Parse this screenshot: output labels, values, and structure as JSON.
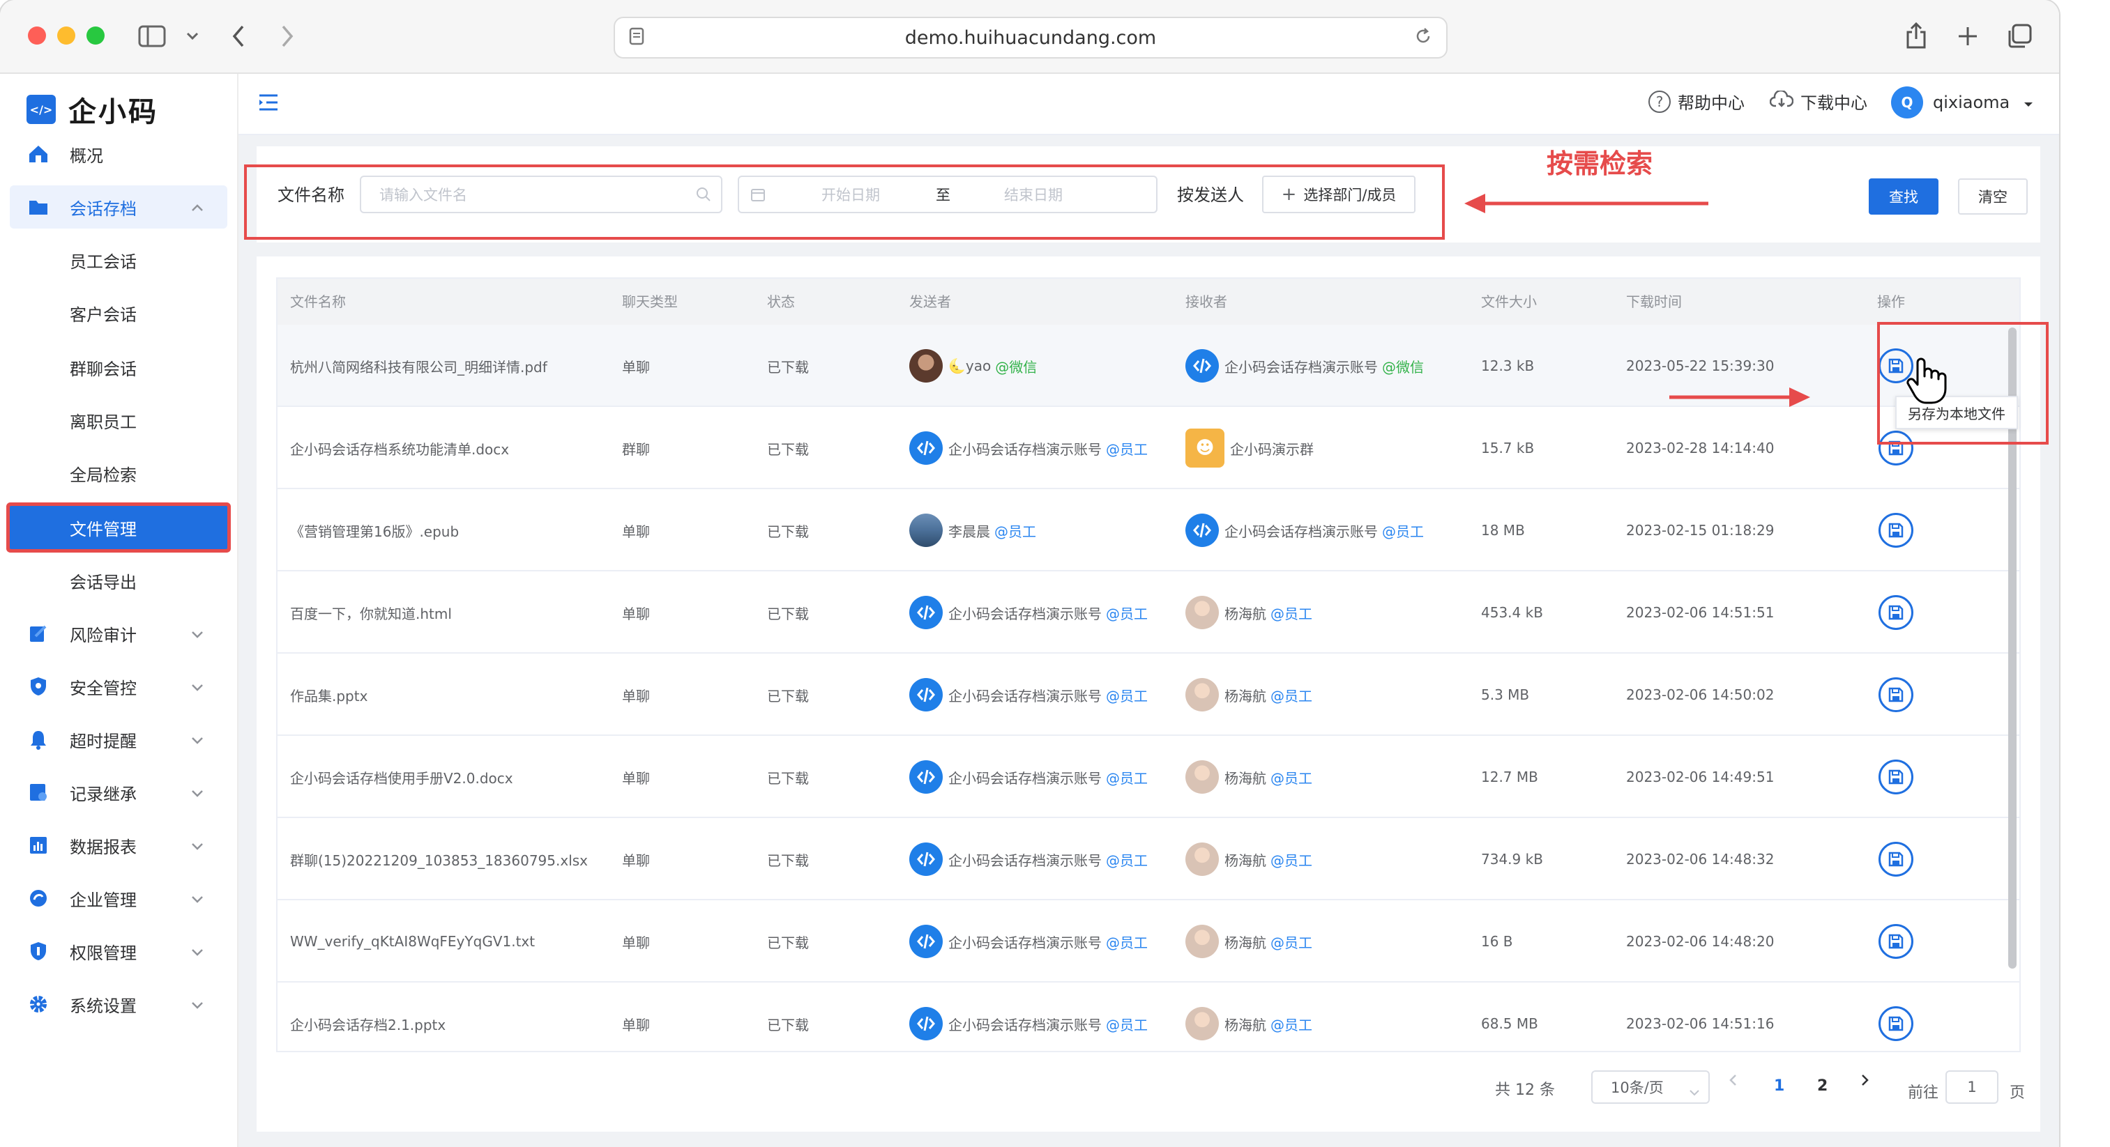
{
  "browser": {
    "url": "demo.huihuacundang.com"
  },
  "brand": {
    "name": "企小码",
    "logo_glyph": "</>",
    "primary_color": "#1f6fe0",
    "annotation_color": "#e64b4b"
  },
  "sidebar": {
    "items": [
      {
        "label": "概况",
        "icon": "home-icon"
      },
      {
        "label": "会话存档",
        "icon": "folder-icon",
        "expanded": true
      },
      {
        "label": "风险审计",
        "icon": "audit-icon"
      },
      {
        "label": "安全管控",
        "icon": "shield-icon"
      },
      {
        "label": "超时提醒",
        "icon": "bell-icon"
      },
      {
        "label": "记录继承",
        "icon": "inherit-icon"
      },
      {
        "label": "数据报表",
        "icon": "chart-icon"
      },
      {
        "label": "企业管理",
        "icon": "enterprise-icon"
      },
      {
        "label": "权限管理",
        "icon": "permission-icon"
      },
      {
        "label": "系统设置",
        "icon": "gear-icon"
      }
    ],
    "sub_items": [
      "员工会话",
      "客户会话",
      "群聊会话",
      "离职员工",
      "全局检索",
      "文件管理",
      "会话导出"
    ],
    "active_sub": "文件管理"
  },
  "header": {
    "help": "帮助中心",
    "download": "下载中心",
    "user": "qixiaoma",
    "avatar_letter": "Q"
  },
  "search": {
    "file_name_label": "文件名称",
    "file_name_placeholder": "请输入文件名",
    "start_date_placeholder": "开始日期",
    "date_separator": "至",
    "end_date_placeholder": "结束日期",
    "sender_label": "按发送人",
    "select_member": "选择部门/成员",
    "search_button": "查找",
    "clear_button": "清空",
    "annotation": "按需检索"
  },
  "table": {
    "columns": [
      "文件名称",
      "聊天类型",
      "状态",
      "发送者",
      "接收者",
      "文件大小",
      "下载时间",
      "操作"
    ],
    "rows": [
      {
        "file": "杭州八简网络科技有限公司_明细详情.pdf",
        "type": "单聊",
        "status": "已下载",
        "sender": "🌜yao",
        "sender_tag": "@微信",
        "sender_av": "photo1",
        "receiver": "企小码会话存档演示账号",
        "receiver_tag": "@微信",
        "receiver_av": "logo",
        "size": "12.3 kB",
        "time": "2023-05-22 15:39:30"
      },
      {
        "file": "企小码会话存档系统功能清单.docx",
        "type": "群聊",
        "status": "已下载",
        "sender": "企小码会话存档演示账号",
        "sender_tag": "@员工",
        "sender_av": "logo",
        "receiver": "企小码演示群",
        "receiver_tag": "",
        "receiver_av": "group",
        "size": "15.7 kB",
        "time": "2023-02-28 14:14:40"
      },
      {
        "file": "《营销管理第16版》.epub",
        "type": "单聊",
        "status": "已下载",
        "sender": "李晨晨",
        "sender_tag": "@员工",
        "sender_av": "photo2",
        "receiver": "企小码会话存档演示账号",
        "receiver_tag": "@员工",
        "receiver_av": "logo",
        "size": "18 MB",
        "time": "2023-02-15 01:18:29"
      },
      {
        "file": "百度一下，你就知道.html",
        "type": "单聊",
        "status": "已下载",
        "sender": "企小码会话存档演示账号",
        "sender_tag": "@员工",
        "sender_av": "logo",
        "receiver": "杨海航",
        "receiver_tag": "@员工",
        "receiver_av": "person",
        "size": "453.4 kB",
        "time": "2023-02-06 14:51:51"
      },
      {
        "file": "作品集.pptx",
        "type": "单聊",
        "status": "已下载",
        "sender": "企小码会话存档演示账号",
        "sender_tag": "@员工",
        "sender_av": "logo",
        "receiver": "杨海航",
        "receiver_tag": "@员工",
        "receiver_av": "person",
        "size": "5.3 MB",
        "time": "2023-02-06 14:50:02"
      },
      {
        "file": "企小码会话存档使用手册V2.0.docx",
        "type": "单聊",
        "status": "已下载",
        "sender": "企小码会话存档演示账号",
        "sender_tag": "@员工",
        "sender_av": "logo",
        "receiver": "杨海航",
        "receiver_tag": "@员工",
        "receiver_av": "person",
        "size": "12.7 MB",
        "time": "2023-02-06 14:49:51"
      },
      {
        "file": "群聊(15)20221209_103853_18360795.xlsx",
        "type": "单聊",
        "status": "已下载",
        "sender": "企小码会话存档演示账号",
        "sender_tag": "@员工",
        "sender_av": "logo",
        "receiver": "杨海航",
        "receiver_tag": "@员工",
        "receiver_av": "person",
        "size": "734.9 kB",
        "time": "2023-02-06 14:48:32"
      },
      {
        "file": "WW_verify_qKtAI8WqFEyYqGV1.txt",
        "type": "单聊",
        "status": "已下载",
        "sender": "企小码会话存档演示账号",
        "sender_tag": "@员工",
        "sender_av": "logo",
        "receiver": "杨海航",
        "receiver_tag": "@员工",
        "receiver_av": "person",
        "size": "16 B",
        "time": "2023-02-06 14:48:20"
      },
      {
        "file": "企小码会话存档2.1.pptx",
        "type": "单聊",
        "status": "已下载",
        "sender": "企小码会话存档演示账号",
        "sender_tag": "@员工",
        "sender_av": "logo",
        "receiver": "杨海航",
        "receiver_tag": "@员工",
        "receiver_av": "person",
        "size": "68.5 MB",
        "time": "2023-02-06 14:51:16"
      }
    ],
    "tooltip": "另存为本地文件"
  },
  "pagination": {
    "total": "共 12 条",
    "page_size": "10条/页",
    "pages": [
      "1",
      "2"
    ],
    "current": "1",
    "goto_label": "前往",
    "goto_value": "1",
    "page_suffix": "页"
  }
}
